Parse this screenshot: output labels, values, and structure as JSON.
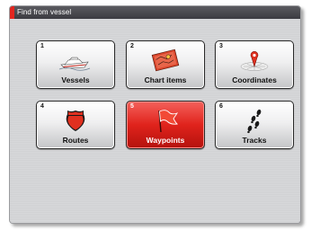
{
  "dialog": {
    "title": "Find from vessel"
  },
  "tiles": [
    {
      "number": "1",
      "label": "Vessels",
      "icon": "boat-icon",
      "selected": false
    },
    {
      "number": "2",
      "label": "Chart items",
      "icon": "chart-items-icon",
      "selected": false
    },
    {
      "number": "3",
      "label": "Coordinates",
      "icon": "coordinates-icon",
      "selected": false
    },
    {
      "number": "4",
      "label": "Routes",
      "icon": "route-shield-icon",
      "selected": false
    },
    {
      "number": "5",
      "label": "Waypoints",
      "icon": "waypoint-flag-icon",
      "selected": true
    },
    {
      "number": "6",
      "label": "Tracks",
      "icon": "footprints-icon",
      "selected": false
    }
  ],
  "colors": {
    "accent": "#e3261f",
    "titlebar": "#3b3b40",
    "selected_tile": "#e0231c"
  }
}
